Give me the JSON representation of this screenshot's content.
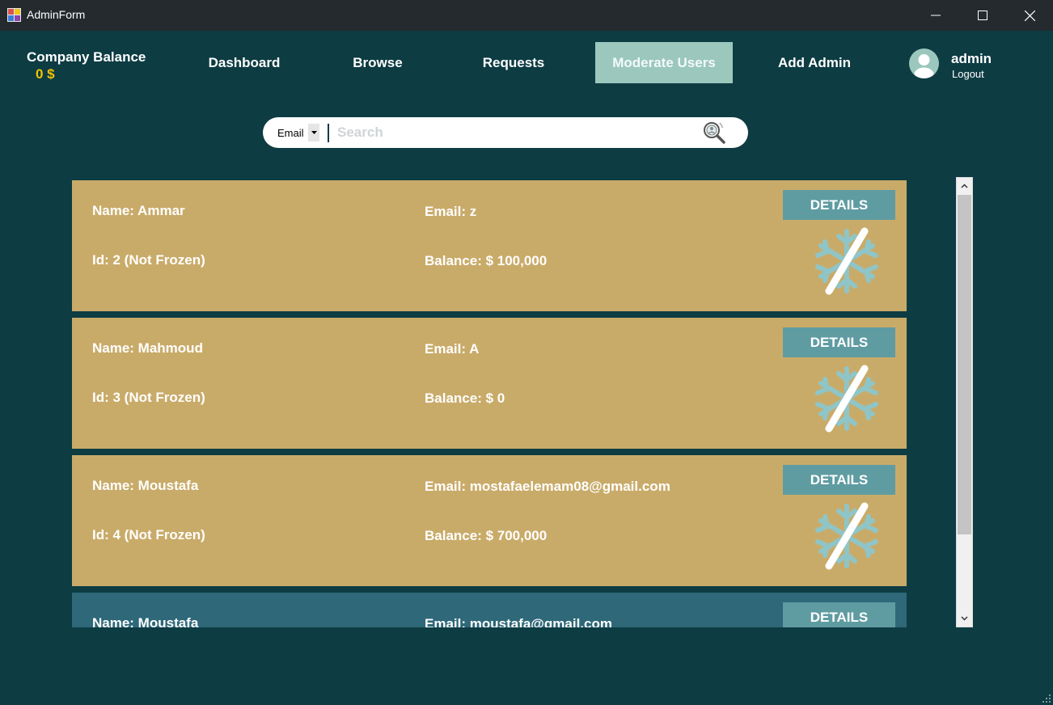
{
  "window": {
    "title": "AdminForm"
  },
  "header": {
    "balance_label": "Company Balance",
    "balance_value": "0 $",
    "nav": [
      {
        "label": "Dashboard",
        "active": false
      },
      {
        "label": "Browse",
        "active": false
      },
      {
        "label": "Requests",
        "active": false
      },
      {
        "label": "Moderate Users",
        "active": true
      },
      {
        "label": "Add Admin",
        "active": false
      }
    ],
    "user": {
      "name": "admin",
      "logout_label": "Logout"
    }
  },
  "search": {
    "filter_value": "Email",
    "placeholder": "Search"
  },
  "users": [
    {
      "name": "Name: Ammar",
      "idline": "Id: 2  (Not Frozen)",
      "email": "Email: z",
      "balance": "Balance: $ 100,000",
      "details_label": "DETAILS"
    },
    {
      "name": "Name: Mahmoud",
      "idline": "Id: 3  (Not Frozen)",
      "email": "Email: A",
      "balance": "Balance: $ 0",
      "details_label": "DETAILS"
    },
    {
      "name": "Name: Moustafa",
      "idline": "Id: 4  (Not Frozen)",
      "email": "Email: mostafaelemam08@gmail.com",
      "balance": "Balance: $ 700,000",
      "details_label": "DETAILS"
    },
    {
      "name": "Name: Moustafa",
      "email": "Email: moustafa@gmail.com",
      "details_label": "DETAILS"
    }
  ],
  "colors": {
    "background": "#0d3c43",
    "card": "#c9ab69",
    "card_selected": "#2e6879",
    "accent": "#9bc7bd",
    "button": "#5f9ca2",
    "balance_value": "#f2c200"
  },
  "icons": {
    "app": "app-icon",
    "search": "search-icon",
    "freeze": "unfreeze-icon",
    "avatar": "user-avatar-icon"
  }
}
